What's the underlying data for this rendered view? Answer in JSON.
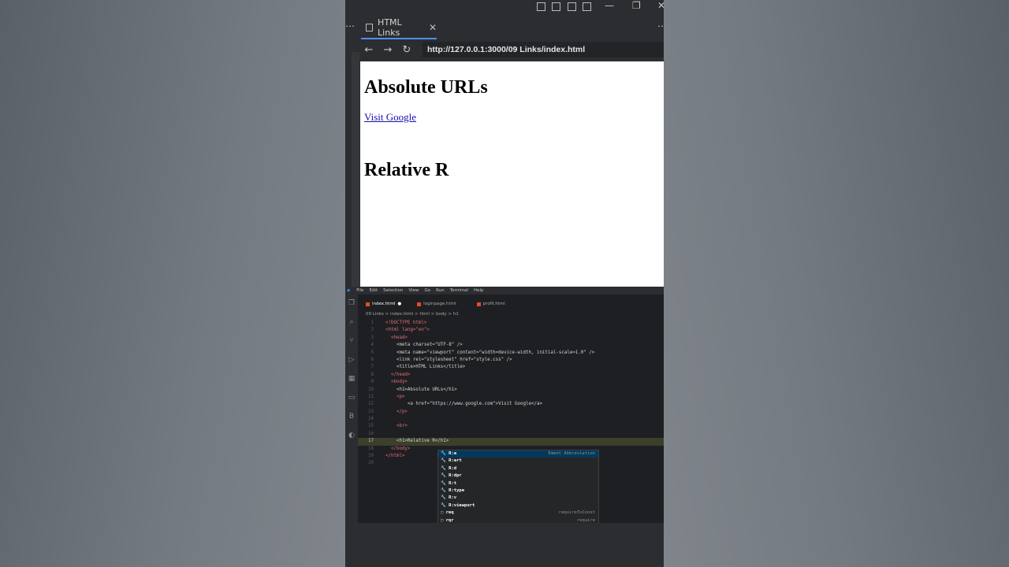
{
  "browser": {
    "tab_title": "HTML Links",
    "tab_close": "✕",
    "url": "http://127.0.0.1:3000/09 Links/index.html"
  },
  "page": {
    "heading1": "Absolute URLs",
    "link": "Visit Google",
    "heading2": "Relative R"
  },
  "editor": {
    "menu": [
      "File",
      "Edit",
      "Selection",
      "View",
      "Go",
      "Run",
      "Terminal",
      "Help"
    ],
    "tabs": [
      {
        "label": "index.html",
        "modified": "●"
      },
      {
        "label": "loginpage.html"
      },
      {
        "label": "profil.html"
      }
    ],
    "breadcrumb": "09 Links  >  index.html  >  html  >  body  >  h1",
    "current_line": "17",
    "lines": [
      {
        "n": "1",
        "code": "<!DOCTYPE html>"
      },
      {
        "n": "2",
        "code": "<html lang=\"en\">"
      },
      {
        "n": "3",
        "code": "  <head>"
      },
      {
        "n": "4",
        "code": "    <meta charset=\"UTF-8\" />"
      },
      {
        "n": "5",
        "code": "    <meta name=\"viewport\" content=\"width=device-width, initial-scale=1.0\" />"
      },
      {
        "n": "6",
        "code": "    <link rel=\"stylesheet\" href=\"style.css\" />"
      },
      {
        "n": "7",
        "code": "    <title>HTML Links</title>"
      },
      {
        "n": "8",
        "code": "  </head>"
      },
      {
        "n": "9",
        "code": "  <body>"
      },
      {
        "n": "10",
        "code": "    <h1>Absolute URLs</h1>"
      },
      {
        "n": "11",
        "code": "    <p>"
      },
      {
        "n": "12",
        "code": "        <a href=\"https://www.google.com\">Visit Google</a>"
      },
      {
        "n": "13",
        "code": "    </p>"
      },
      {
        "n": "14",
        "code": ""
      },
      {
        "n": "15",
        "code": "    <br>"
      },
      {
        "n": "16",
        "code": ""
      },
      {
        "n": "17",
        "code": "    <h1>Relative R</h1>"
      },
      {
        "n": "18",
        "code": "  </body>"
      },
      {
        "n": "19",
        "code": "</html>"
      },
      {
        "n": "20",
        "code": ""
      }
    ],
    "suggestions": [
      {
        "label": "R:a",
        "detail": "Emmet Abbreviation"
      },
      {
        "label": "R:art",
        "detail": ""
      },
      {
        "label": "R:d",
        "detail": ""
      },
      {
        "label": "R:dpr",
        "detail": ""
      },
      {
        "label": "R:t",
        "detail": ""
      },
      {
        "label": "R:type",
        "detail": ""
      },
      {
        "label": "R:v",
        "detail": ""
      },
      {
        "label": "R:viewport",
        "detail": ""
      },
      {
        "label": "req",
        "detail": "requireToConst"
      },
      {
        "label": "rqr",
        "detail": "require"
      }
    ]
  }
}
